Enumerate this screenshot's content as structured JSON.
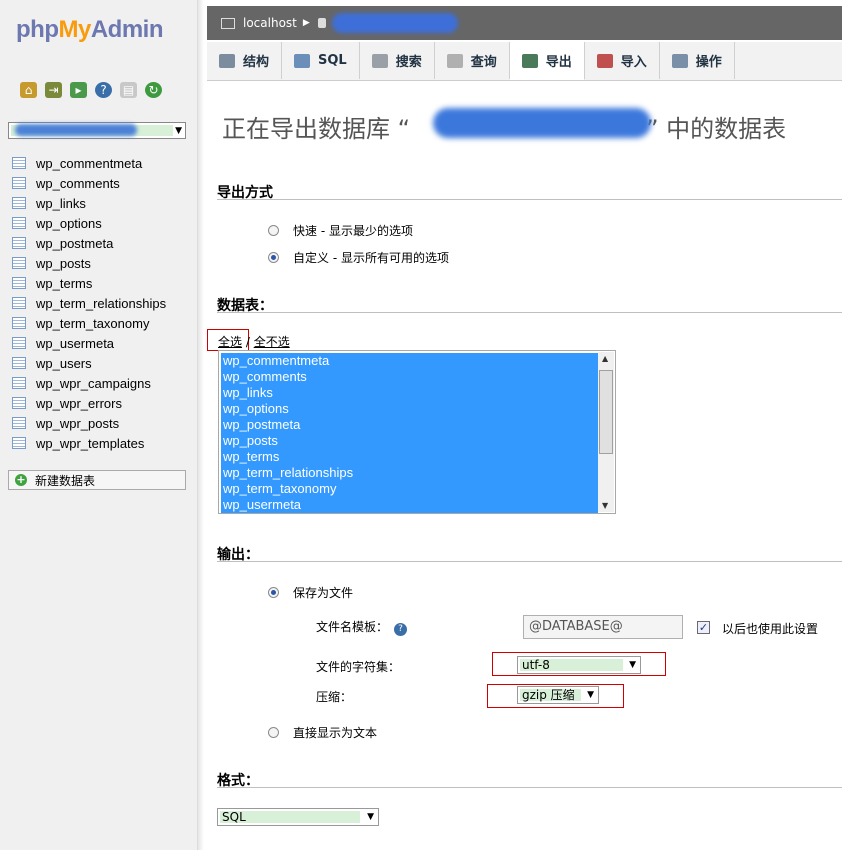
{
  "app": {
    "logo": {
      "part1": "php",
      "part2": "My",
      "part3": "Admin"
    }
  },
  "nav": {
    "icons": [
      "home-icon",
      "logout-icon",
      "sql-query-icon",
      "help-icon",
      "docs-icon",
      "reload-icon"
    ],
    "tables": [
      "wp_commentmeta",
      "wp_comments",
      "wp_links",
      "wp_options",
      "wp_postmeta",
      "wp_posts",
      "wp_terms",
      "wp_term_relationships",
      "wp_term_taxonomy",
      "wp_usermeta",
      "wp_users",
      "wp_wpr_campaigns",
      "wp_wpr_errors",
      "wp_wpr_posts",
      "wp_wpr_templates"
    ],
    "new_table": "新建数据表"
  },
  "breadcrumb": {
    "server": "localhost"
  },
  "tabs": [
    {
      "label": "结构",
      "icon": "structure-icon"
    },
    {
      "label": "SQL",
      "icon": "sql-icon"
    },
    {
      "label": "搜索",
      "icon": "search-icon"
    },
    {
      "label": "查询",
      "icon": "query-icon"
    },
    {
      "label": "导出",
      "icon": "export-icon",
      "active": true
    },
    {
      "label": "导入",
      "icon": "import-icon"
    },
    {
      "label": "操作",
      "icon": "wrench-icon"
    }
  ],
  "main": {
    "title_prefix": "正在导出数据库 “",
    "title_suffix": "” 中的数据表",
    "export_method": {
      "heading": "导出方式",
      "quick": "快速 - 显示最少的选项",
      "custom": "自定义 - 显示所有可用的选项",
      "selected": "custom"
    },
    "tables_section": {
      "heading": "数据表：",
      "select_all": "全选",
      "separator": " / ",
      "deselect_all": "全不选",
      "items": [
        "wp_commentmeta",
        "wp_comments",
        "wp_links",
        "wp_options",
        "wp_postmeta",
        "wp_posts",
        "wp_terms",
        "wp_term_relationships",
        "wp_term_taxonomy",
        "wp_usermeta"
      ]
    },
    "output": {
      "heading": "输出：",
      "save_to_file": "保存为文件",
      "filename_template_label": "文件名模板：",
      "filename_template_value": "@DATABASE@",
      "use_for_future": "以后也使用此设置",
      "use_for_future_checked": true,
      "charset_label": "文件的字符集：",
      "charset_value": "utf-8",
      "compression_label": "压缩：",
      "compression_value": "gzip 压缩",
      "show_as_text": "直接显示为文本"
    },
    "format": {
      "heading": "格式：",
      "value": "SQL"
    }
  },
  "colors": {
    "selection": "#3399ff",
    "highlight_border": "#d00000",
    "select_fill": "#d7f0d7"
  }
}
